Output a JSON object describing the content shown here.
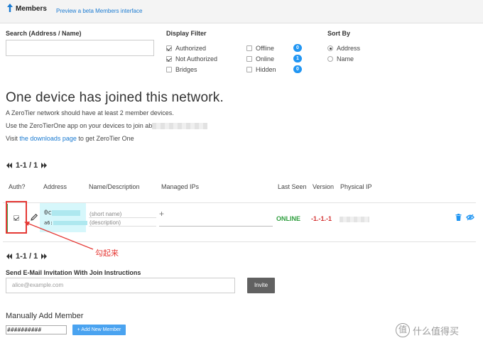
{
  "header": {
    "title": "Members",
    "beta_link": "Preview a beta Members interface"
  },
  "search": {
    "label": "Search (Address / Name)",
    "value": ""
  },
  "display_filter": {
    "label": "Display Filter",
    "options": [
      {
        "label": "Authorized",
        "checked": true
      },
      {
        "label": "Not Authorized",
        "checked": true
      },
      {
        "label": "Bridges",
        "checked": false
      },
      {
        "label": "Offline",
        "checked": false,
        "count": "0"
      },
      {
        "label": "Online",
        "checked": false,
        "count": "1"
      },
      {
        "label": "Hidden",
        "checked": false,
        "count": "0"
      }
    ]
  },
  "sort_by": {
    "label": "Sort By",
    "options": [
      {
        "label": "Address",
        "selected": true
      },
      {
        "label": "Name",
        "selected": false
      }
    ]
  },
  "joined": {
    "title": "One device has joined this network.",
    "line1": "A ZeroTier network should have at least 2 member devices.",
    "line2": "Use the ZeroTierOne app on your devices to join ab",
    "line3_pre": "Visit ",
    "line3_link": "the downloads page",
    "line3_post": " to get ZeroTier One"
  },
  "pagination": {
    "text": "1-1 / 1"
  },
  "table": {
    "headers": [
      "Auth?",
      "Address",
      "Name/Description",
      "Managed IPs",
      "Last Seen",
      "Version",
      "Physical IP"
    ],
    "row": {
      "authorized": true,
      "address_line1": "0c",
      "address_line2": "a6:",
      "name_placeholder": "(short name)",
      "description_placeholder": "(description)",
      "managed_ip_add": "+",
      "last_seen": "ONLINE",
      "version": "-1.-1.-1"
    }
  },
  "annotation": "勾起来",
  "invite": {
    "label": "Send E-Mail Invitation With Join Instructions",
    "placeholder": "alice@example.com",
    "button": "Invite"
  },
  "manual_add": {
    "title": "Manually Add Member",
    "value": "##########",
    "button": "+ Add New Member"
  },
  "watermark": {
    "mark": "值",
    "text": "什么值得买"
  },
  "colors": {
    "link": "#1a7ad1",
    "badge": "#2196f3",
    "online": "#2e9e3e",
    "version": "#d32f2f",
    "annotation": "#e53935",
    "address_highlight": "#d6f7fb"
  }
}
